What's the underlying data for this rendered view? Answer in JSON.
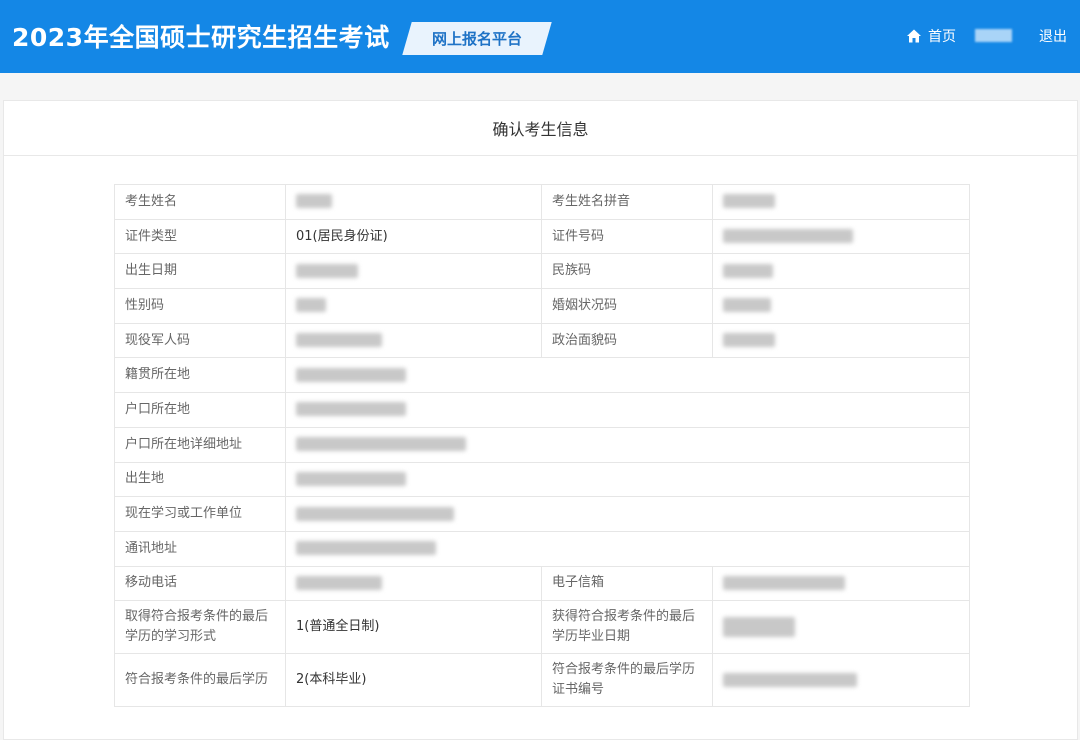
{
  "header": {
    "title": "2023年全国硕士研究生招生考试",
    "platform_badge": "网上报名平台",
    "nav_home": "首页",
    "nav_logout": "退出"
  },
  "card": {
    "title": "确认考生信息"
  },
  "rows": [
    {
      "l1": "考生姓名",
      "v1": "",
      "l2": "考生姓名拼音",
      "v2": ""
    },
    {
      "l1": "证件类型",
      "v1": "01(居民身份证)",
      "l2": "证件号码",
      "v2": ""
    },
    {
      "l1": "出生日期",
      "v1": "",
      "l2": "民族码",
      "v2": ""
    },
    {
      "l1": "性别码",
      "v1": "",
      "l2": "婚姻状况码",
      "v2": ""
    },
    {
      "l1": "现役军人码",
      "v1": "",
      "l2": "政治面貌码",
      "v2": ""
    },
    {
      "l1": "籍贯所在地",
      "v1": ""
    },
    {
      "l1": "户口所在地",
      "v1": ""
    },
    {
      "l1": "户口所在地详细地址",
      "v1": ""
    },
    {
      "l1": "出生地",
      "v1": ""
    },
    {
      "l1": "现在学习或工作单位",
      "v1": ""
    },
    {
      "l1": "通讯地址",
      "v1": ""
    },
    {
      "l1": "移动电话",
      "v1": "",
      "l2": "电子信箱",
      "v2": ""
    },
    {
      "l1": "取得符合报考条件的最后学历的学习形式",
      "v1": "1(普通全日制)",
      "l2": "获得符合报考条件的最后学历毕业日期",
      "v2": ""
    },
    {
      "l1": "符合报考条件的最后学历",
      "v1": "2(本科毕业)",
      "l2": "符合报考条件的最后学历证书编号",
      "v2": ""
    }
  ]
}
